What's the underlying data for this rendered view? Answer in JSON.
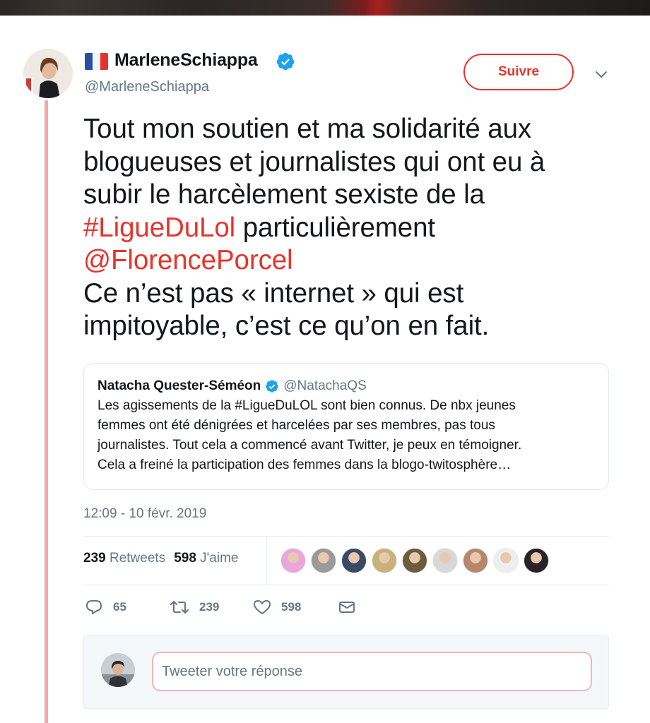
{
  "colors": {
    "accent": "#e8332b",
    "text": "#14171a",
    "muted": "#657786",
    "verified": "#1da1f2",
    "thread_line": "#f3a6a6"
  },
  "author": {
    "name": "MarleneSchiappa",
    "handle": "@MarleneSchiappa",
    "flag_icon": "flag-france-icon",
    "verified_icon": "verified-badge-icon"
  },
  "follow_button": {
    "label": "Suivre"
  },
  "menu_icon": "chevron-down-icon",
  "tweet": {
    "lines": [
      "Tout mon soutien et ma solidarité aux",
      "blogueuses et journalistes qui ont eu à",
      "subir le harcèlement sexiste de la"
    ],
    "hashtag": "#LigueDuLol",
    "after_hashtag": " particulièrement",
    "mention": "@FlorencePorcel",
    "closing_lines": [
      "Ce n’est pas « internet » qui est",
      "impitoyable, c’est ce qu’on en fait."
    ]
  },
  "quoted_tweet": {
    "name": "Natacha Quester-Séméon",
    "handle": "@NatachaQS",
    "lines": [
      "Les agissements de la #LigueDuLOL sont bien connus. De nbx jeunes",
      "femmes ont été dénigrées et harcelées par ses membres, pas tous",
      "journalistes. Tout cela a commencé avant Twitter, je peux en témoigner.",
      "Cela a freiné la participation des femmes dans la blogo-twitosphère…"
    ]
  },
  "timestamp": "12:09 - 10 févr. 2019",
  "stats": {
    "retweets_count": "239",
    "retweets_label": "Retweets",
    "likes_count": "598",
    "likes_label": "J'aime"
  },
  "likers": [
    {
      "name": "liker-1",
      "color": "#e9a6dc"
    },
    {
      "name": "liker-2",
      "color": "#9a9a9a"
    },
    {
      "name": "liker-3",
      "color": "#3b4a63"
    },
    {
      "name": "liker-4",
      "color": "#c9b27a"
    },
    {
      "name": "liker-5",
      "color": "#6e5a3c"
    },
    {
      "name": "liker-6",
      "color": "#d8d8d8"
    },
    {
      "name": "liker-7",
      "color": "#b8876a"
    },
    {
      "name": "liker-8",
      "color": "#eeeeee"
    },
    {
      "name": "liker-9",
      "color": "#2a2226"
    }
  ],
  "actions": {
    "reply_count": "65",
    "retweet_count": "239",
    "like_count": "598",
    "reply_icon": "reply-icon",
    "retweet_icon": "retweet-icon",
    "like_icon": "heart-icon",
    "message_icon": "envelope-icon"
  },
  "reply": {
    "placeholder": "Tweeter votre réponse"
  }
}
